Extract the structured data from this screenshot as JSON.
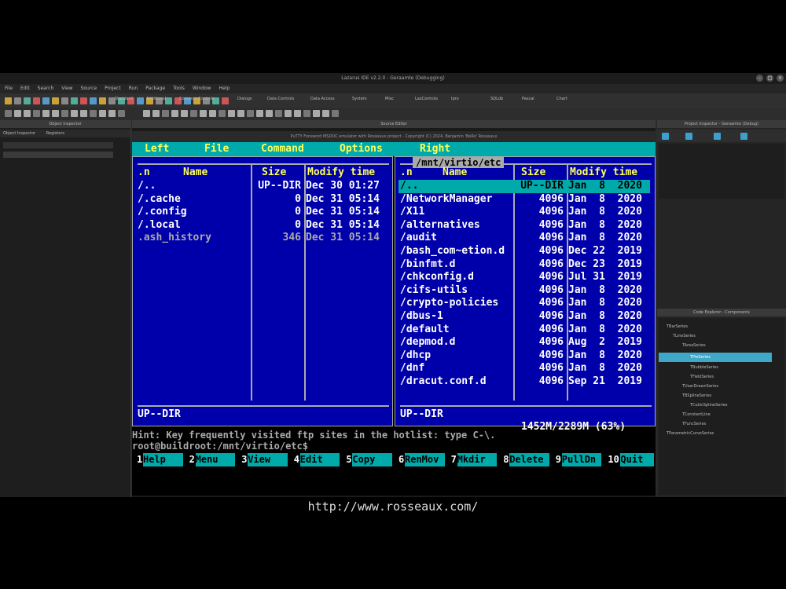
{
  "ide": {
    "window_title": "Lazarus IDE v2.2.0 - Geraamte (Debugging)",
    "menu": [
      "File",
      "Edit",
      "Search",
      "View",
      "Source",
      "Project",
      "Run",
      "Package",
      "Tools",
      "Window",
      "Help"
    ],
    "component_tabs": [
      "Standard",
      "Additional",
      "Common Controls",
      "Dialogs",
      "Data Controls",
      "Data Access",
      "System",
      "Misc",
      "LazControls",
      "Ipro",
      "SQLdb",
      "Pascal",
      "Chart"
    ],
    "left_panel_title": "Object Inspector",
    "left_panel_tabs": [
      "Object Inspector",
      "Registers"
    ],
    "editor_title": "Source Editor",
    "right_panel_title": "Project Inspector - Geraamte (Debug)",
    "code_explorer_title": "Code Explorer - Components",
    "tree_items": [
      "TBarSeries",
      "TLineSeries",
      "TAreaSeries",
      "TPieSeries",
      "TBubbleSeries",
      "TFieldSeries",
      "TUserDrawnSeries",
      "TBSplineSeries",
      "TCubicSplineSeries",
      "TConstantLine",
      "TFuncSeries",
      "TParametricCurveSeries"
    ]
  },
  "terminal": {
    "window_title": "PuTTY Foreword MSDOC emulator with Rosseaux project - Copyright (C) 2024, Benjamin 'BeRo' Rosseaux",
    "menu": [
      "Left",
      "File",
      "Command",
      "Options",
      "Right"
    ],
    "left_panel": {
      "path": "",
      "headers": {
        "name_prefix": ".n",
        "name": "Name",
        "size": "Size",
        "modify": "Modify time"
      },
      "rows": [
        {
          "name": "/..",
          "size": "UP--DIR",
          "date": "Dec 30 01:27",
          "style": "dir"
        },
        {
          "name": "/.cache",
          "size": "0",
          "date": "Dec 31 05:14",
          "style": "dir"
        },
        {
          "name": "/.config",
          "size": "0",
          "date": "Dec 31 05:14",
          "style": "dir"
        },
        {
          "name": "/.local",
          "size": "0",
          "date": "Dec 31 05:14",
          "style": "dir"
        },
        {
          "name": " .ash_history",
          "size": "346",
          "date": "Dec 31 05:14",
          "style": "dim"
        }
      ],
      "status": "UP--DIR"
    },
    "right_panel": {
      "path": "/mnt/virtio/etc",
      "headers": {
        "name_prefix": ".n",
        "name": "Name",
        "size": "Size",
        "modify": "Modify time"
      },
      "rows": [
        {
          "name": "/..",
          "size": "UP--DIR",
          "date": "Jan  8  2020",
          "style": "sel"
        },
        {
          "name": "/NetworkManager",
          "size": "4096",
          "date": "Jan  8  2020",
          "style": "dir"
        },
        {
          "name": "/X11",
          "size": "4096",
          "date": "Jan  8  2020",
          "style": "dir"
        },
        {
          "name": "/alternatives",
          "size": "4096",
          "date": "Jan  8  2020",
          "style": "dir"
        },
        {
          "name": "/audit",
          "size": "4096",
          "date": "Jan  8  2020",
          "style": "dir"
        },
        {
          "name": "/bash_com~etion.d",
          "size": "4096",
          "date": "Dec 22  2019",
          "style": "dir"
        },
        {
          "name": "/binfmt.d",
          "size": "4096",
          "date": "Dec 23  2019",
          "style": "dir"
        },
        {
          "name": "/chkconfig.d",
          "size": "4096",
          "date": "Jul 31  2019",
          "style": "dir"
        },
        {
          "name": "/cifs-utils",
          "size": "4096",
          "date": "Jan  8  2020",
          "style": "dir"
        },
        {
          "name": "/crypto-policies",
          "size": "4096",
          "date": "Jan  8  2020",
          "style": "dir"
        },
        {
          "name": "/dbus-1",
          "size": "4096",
          "date": "Jan  8  2020",
          "style": "dir"
        },
        {
          "name": "/default",
          "size": "4096",
          "date": "Jan  8  2020",
          "style": "dir"
        },
        {
          "name": "/depmod.d",
          "size": "4096",
          "date": "Aug  2  2019",
          "style": "dir"
        },
        {
          "name": "/dhcp",
          "size": "4096",
          "date": "Jan  8  2020",
          "style": "dir"
        },
        {
          "name": "/dnf",
          "size": "4096",
          "date": "Jan  8  2020",
          "style": "dir"
        },
        {
          "name": "/dracut.conf.d",
          "size": "4096",
          "date": "Sep 21  2019",
          "style": "dir"
        }
      ],
      "status": "UP--DIR",
      "disk_info": "1452M/2289M (63%)"
    },
    "hint": "Hint: Key frequently visited ftp sites in the hotlist: type C-\\.",
    "prompt": "root@buildroot:/mnt/virtio/etc$",
    "function_keys": [
      {
        "num": "1",
        "label": "Help"
      },
      {
        "num": "2",
        "label": "Menu"
      },
      {
        "num": "3",
        "label": "View"
      },
      {
        "num": "4",
        "label": "Edit"
      },
      {
        "num": "5",
        "label": "Copy"
      },
      {
        "num": "6",
        "label": "RenMov"
      },
      {
        "num": "7",
        "label": "Mkdir"
      },
      {
        "num": "8",
        "label": "Delete"
      },
      {
        "num": "9",
        "label": "PullDn"
      },
      {
        "num": "10",
        "label": "Quit"
      }
    ]
  },
  "footer_url": "http://www.rosseaux.com/",
  "colors": {
    "panel_bg": "#0000aa",
    "cyan": "#00aaaa",
    "yellow": "#ffff55"
  }
}
